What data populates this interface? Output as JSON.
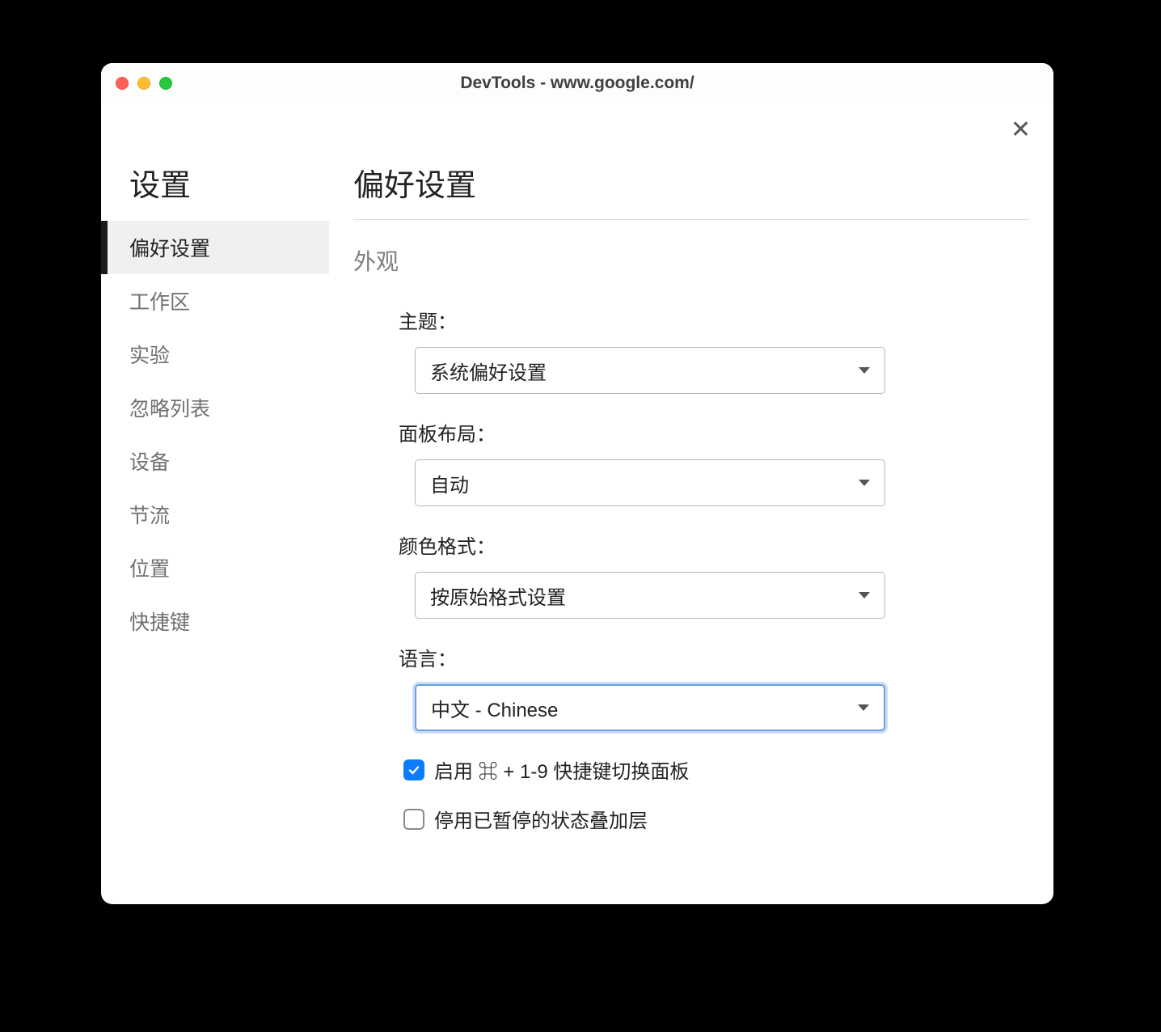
{
  "window": {
    "title": "DevTools - www.google.com/"
  },
  "sidebar": {
    "title": "设置",
    "items": [
      {
        "label": "偏好设置",
        "active": true
      },
      {
        "label": "工作区",
        "active": false
      },
      {
        "label": "实验",
        "active": false
      },
      {
        "label": "忽略列表",
        "active": false
      },
      {
        "label": "设备",
        "active": false
      },
      {
        "label": "节流",
        "active": false
      },
      {
        "label": "位置",
        "active": false
      },
      {
        "label": "快捷键",
        "active": false
      }
    ]
  },
  "page": {
    "heading": "偏好设置",
    "section": "外观",
    "fields": {
      "theme": {
        "label": "主题：",
        "value": "系统偏好设置"
      },
      "panel_layout": {
        "label": "面板布局：",
        "value": "自动"
      },
      "color_format": {
        "label": "颜色格式：",
        "value": "按原始格式设置"
      },
      "language": {
        "label": "语言：",
        "value": "中文 - Chinese"
      }
    },
    "checkboxes": {
      "shortcut_switch": {
        "label": "启用 ⌘ + 1-9 快捷键切换面板",
        "checked": true
      },
      "disable_overlay": {
        "label": "停用已暂停的状态叠加层",
        "checked": false
      }
    }
  }
}
